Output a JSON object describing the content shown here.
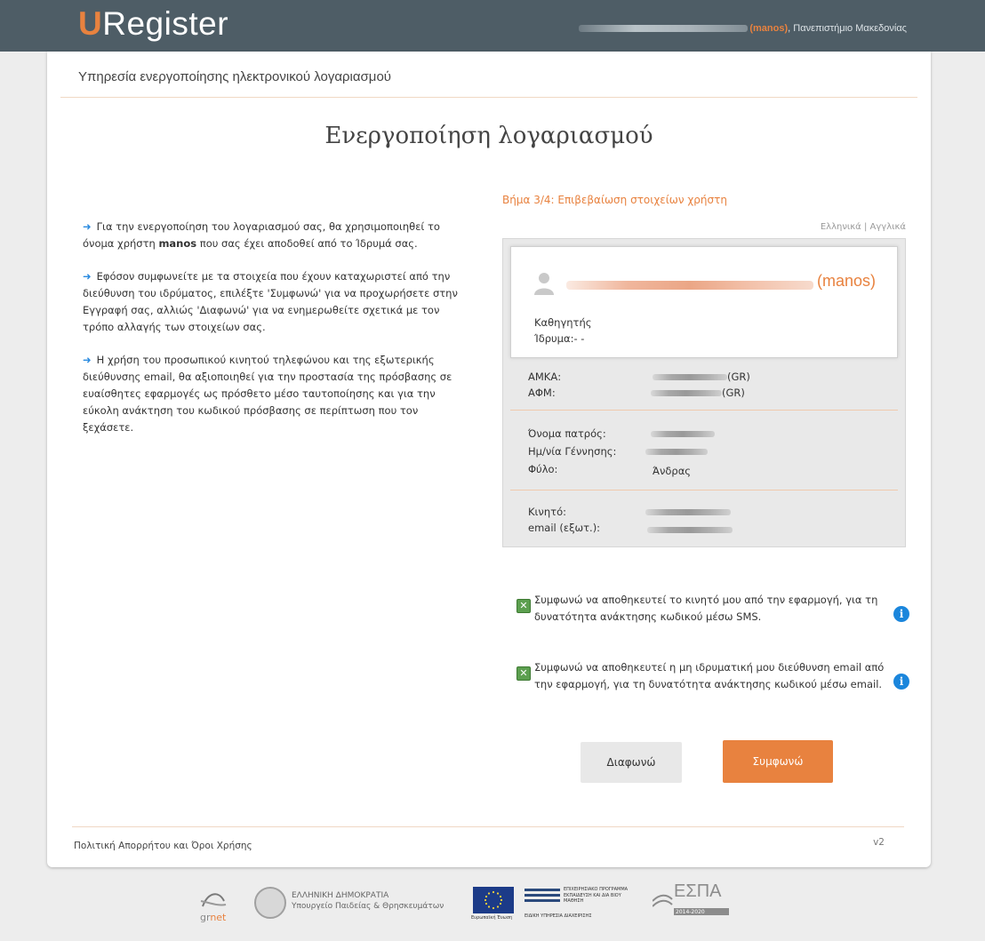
{
  "header": {
    "logo_u": "U",
    "logo_rest": "Register",
    "user_open": "(",
    "user_name": "manos",
    "user_close": ")",
    "institution": ", Πανεπιστήμιο Μακεδονίας"
  },
  "page": {
    "subtitle": "Υπηρεσία ενεργοποίησης ηλεκτρονικού λογαριασμού",
    "title": "Ενεργοποίηση λογαριασμού"
  },
  "instructions": {
    "p1_before": "Για την ενεργοποίηση του λογαριασμού σας, θα χρησιμοποιηθεί το όνομα χρήστη ",
    "p1_user": "manos",
    "p1_after": " που σας έχει αποδοθεί από το Ίδρυμά σας.",
    "p2": "Εφόσον συμφωνείτε με τα στοιχεία που έχουν καταχωριστεί από την διεύθυνση του ιδρύματος, επιλέξτε 'Συμφωνώ' για να προχωρήσετε στην Εγγραφή σας, αλλιώς 'Διαφωνώ' για να ενημερωθείτε σχετικά με τον τρόπο αλλαγής των στοιχείων σας.",
    "p3": "Η χρήση του προσωπικού κινητού τηλεφώνου και της εξωτερικής διεύθυνσης email, θα αξιοποιηθεί για την προστασία της πρόσβασης σε ευαίσθητες εφαρμογές ως πρόσθετο μέσο ταυτοποίησης και για την εύκολη ανάκτηση του κωδικού πρόσβασης σε περίπτωση που τον ξεχάσετε."
  },
  "step": "Βήμα 3/4: Επιβεβαίωση στοιχείων χρήστη",
  "lang": {
    "greek": "Ελληνικά",
    "sep": "|",
    "english": "Αγγλικά"
  },
  "profile": {
    "username_display": "(manos)",
    "role": "Καθηγητής",
    "institution": "Ίδρυμα:- -"
  },
  "fields": {
    "amka_label": "ΑΜΚΑ:",
    "amka_suffix": "(GR)",
    "afm_label": "ΑΦΜ:",
    "afm_suffix": "(GR)",
    "father_label": "Όνομα πατρός:",
    "dob_label": "Ημ/νία Γέννησης:",
    "gender_label": "Φύλο:",
    "gender_value": "Άνδρας",
    "mobile_label": "Κινητό:",
    "email_label": "email (εξωτ.):"
  },
  "consents": {
    "sms": "Συμφωνώ να αποθηκευτεί το κινητό μου από την εφαρμογή, για τη δυνατότητα ανάκτησης κωδικού μέσω SMS.",
    "email": "Συμφωνώ να αποθηκευτεί η μη ιδρυματική μου διεύθυνση email από την εφαρμογή, για τη δυνατότητα ανάκτησης κωδικού μέσω email."
  },
  "buttons": {
    "disagree": "Διαφωνώ",
    "agree": "Συμφωνώ"
  },
  "footer": {
    "policy": "Πολιτική Απορρήτου και Όροι Χρήσης",
    "version": "v2",
    "grnet_a": "gr",
    "grnet_b": "net",
    "gov_line1": "ΕΛΛΗΝΙΚΗ ΔΗΜΟΚΡΑΤΙΑ",
    "gov_line2": "Υπουργείο Παιδείας & Θρησκευμάτων",
    "eu_text": "Ευρωπαϊκή Ένωση",
    "op_line1": "ΕΠΙΧΕΙΡΗΣΙΑΚΟ ΠΡΟΓΡΑΜΜΑ",
    "op_line2": "ΕΚΠΑΙΔΕΥΣΗ ΚΑΙ ΔΙΑ ΒΙΟΥ ΜΑΘΗΣΗ",
    "op_line3": "ΕΙΔΙΚΗ ΥΠΗΡΕΣΙΑ ΔΙΑΧΕΙΡΙΣΗΣ",
    "espa": "ΕΣΠΑ",
    "espa_years": "2014-2020"
  },
  "colors": {
    "accent": "#e8823f",
    "topbar": "#4e5d66",
    "info": "#1b86dc",
    "check": "#5c9f4f"
  }
}
